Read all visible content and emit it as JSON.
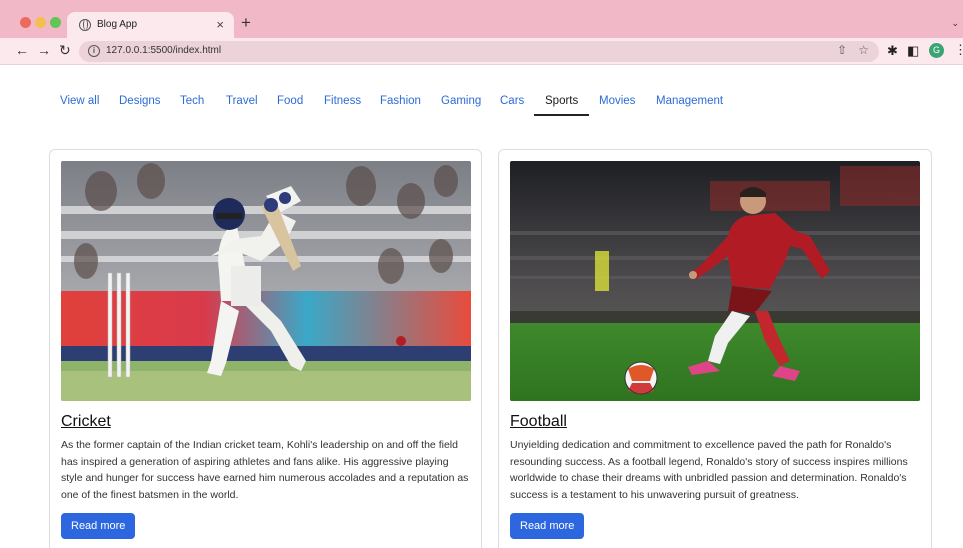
{
  "browser": {
    "tab_title": "Blog App",
    "tab_close": "×",
    "new_tab": "+",
    "url": "127.0.0.1:5500/index.html",
    "profile_initial": "G"
  },
  "nav": {
    "items": [
      {
        "label": "View all"
      },
      {
        "label": "Designs"
      },
      {
        "label": "Tech"
      },
      {
        "label": "Travel"
      },
      {
        "label": "Food"
      },
      {
        "label": "Fitness"
      },
      {
        "label": "Fashion"
      },
      {
        "label": "Gaming"
      },
      {
        "label": "Cars"
      },
      {
        "label": "Sports"
      },
      {
        "label": "Movies"
      },
      {
        "label": "Management"
      }
    ],
    "active": "Sports"
  },
  "cards": [
    {
      "title": "Cricket",
      "text": "As the former captain of the Indian cricket team, Kohli's leadership on and off the field has inspired a generation of aspiring athletes and fans alike. His aggressive playing style and hunger for success have earned him numerous accolades and a reputation as one of the finest batsmen in the world.",
      "button": "Read more"
    },
    {
      "title": "Football",
      "text": "Unyielding dedication and commitment to excellence paved the path for Ronaldo's resounding success. As a football legend, Ronaldo's story of success inspires millions worldwide to chase their dreams with unbridled passion and determination. Ronaldo's success is a testament to his unwavering pursuit of greatness.",
      "button": "Read more"
    }
  ],
  "colors": {
    "accent": "#2d67df",
    "link": "#2c6bd6",
    "chrome": "#f1b8c8"
  }
}
